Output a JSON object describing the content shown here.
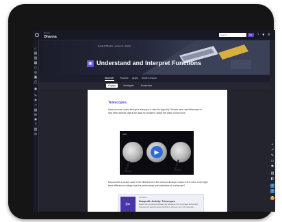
{
  "topbar": {
    "brand_small": "CK-12",
    "brand_main": "Ohanna",
    "search_placeholder": "Search",
    "badge": "ML"
  },
  "hero": {
    "breadcrumb": "Grade 8 Physics • Lesson 3 • Optics",
    "title": "Understand and Interpret Functions",
    "tabs": [
      {
        "label": "Discover"
      },
      {
        "label": "Practice"
      },
      {
        "label": "Apply"
      },
      {
        "label": "Model Lesson"
      }
    ]
  },
  "content_tabs": [
    {
      "label": "Engage"
    },
    {
      "label": "Investigate"
    },
    {
      "label": "Summarize"
    }
  ],
  "doc": {
    "heading": "Telescopes",
    "paragraph": "Have you ever looked through a telescope to view the night sky? People have used telescopes to help them observe objects far away for centuries. Watch the video to learn more.",
    "video_label": "0:00",
    "question": "Discuss with a partner some of the differences in the various telescopes shown in the video. How might these differences change what the performance and usefulness of a telescope?",
    "card": {
      "kicker": "Interactive",
      "title": "Nonprofit: Activity: Telescopes",
      "desc": "Explore the connections between the telescopes from a complete and explore how near and apart the stars contribute to what you see in the telescope."
    }
  },
  "colors": {
    "accent": "#5b3fc4",
    "topbar": "#161823",
    "background": "#23242e"
  }
}
